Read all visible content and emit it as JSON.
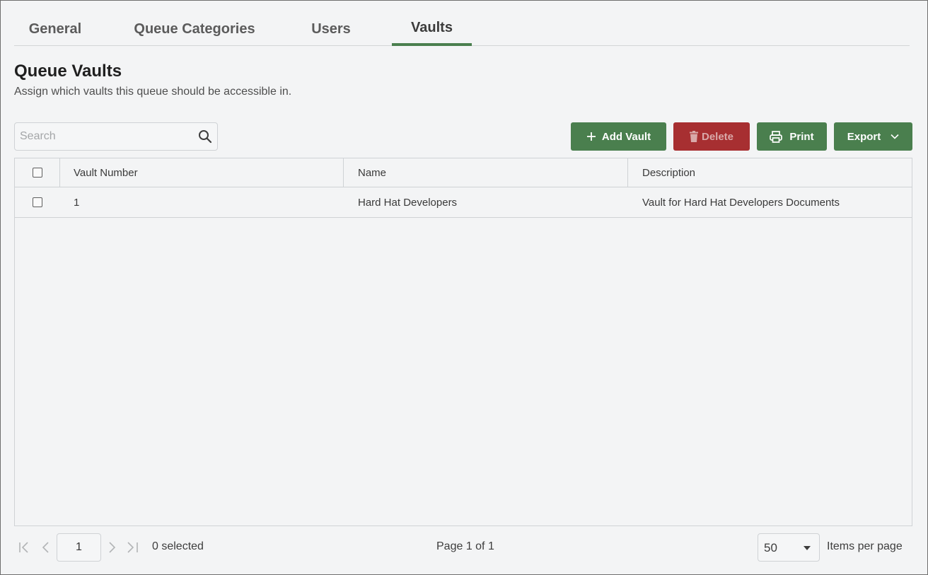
{
  "tabs": [
    {
      "label": "General",
      "active": false
    },
    {
      "label": "Queue Categories",
      "active": false
    },
    {
      "label": "Users",
      "active": false
    },
    {
      "label": "Vaults",
      "active": true
    }
  ],
  "page": {
    "title": "Queue Vaults",
    "subtitle": "Assign which vaults this queue should be accessible in."
  },
  "search": {
    "placeholder": "Search",
    "value": "",
    "icon": "search-icon"
  },
  "toolbar": {
    "add_label": "Add Vault",
    "delete_label": "Delete",
    "print_label": "Print",
    "export_label": "Export"
  },
  "table": {
    "columns": [
      "Vault Number",
      "Name",
      "Description"
    ],
    "rows": [
      {
        "vault_number": "1",
        "name": "Hard Hat Developers",
        "description": "Vault for Hard Hat Developers Documents"
      }
    ]
  },
  "pager": {
    "page_input": "1",
    "selected_text": "0 selected",
    "page_text": "Page 1 of 1",
    "page_size": "50",
    "items_per_page_label": "Items per page"
  },
  "colors": {
    "accent_green": "#4a7f4e",
    "danger_red": "#a72f31",
    "background": "#f3f4f5"
  }
}
